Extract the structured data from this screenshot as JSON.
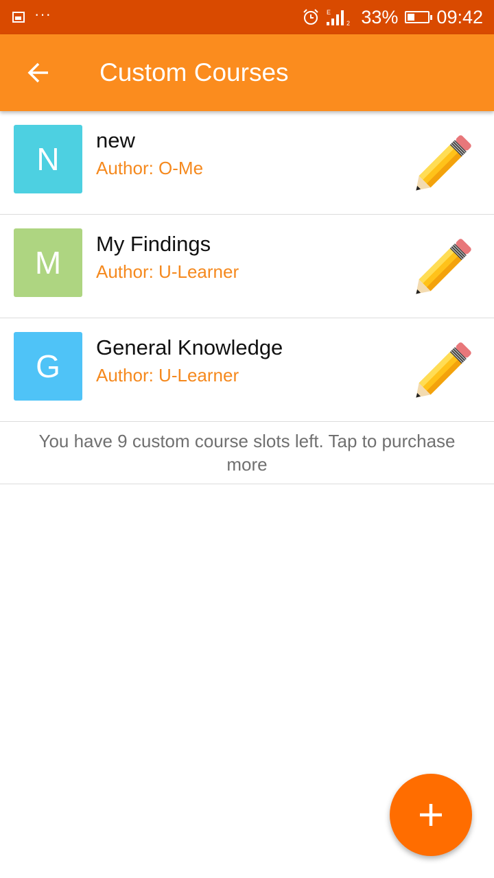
{
  "status_bar": {
    "battery_percent": "33%",
    "battery_level": 0.33,
    "time": "09:42",
    "icons": [
      "image-icon",
      "more-dots-icon",
      "alarm-icon",
      "signal-icon",
      "battery-icon"
    ],
    "dots": "···"
  },
  "app_bar": {
    "title": "Custom Courses",
    "back_icon": "arrow-back-icon",
    "background": "#fb8c1e"
  },
  "courses": [
    {
      "initial": "N",
      "title": "new",
      "author": "Author: O-Me",
      "avatar_color": "#4dd0e1",
      "action_icon": "pencil-icon"
    },
    {
      "initial": "M",
      "title": "My Findings",
      "author": "Author: U-Learner",
      "avatar_color": "#aed581",
      "action_icon": "pencil-icon"
    },
    {
      "initial": "G",
      "title": "General Knowledge",
      "author": "Author: U-Learner",
      "avatar_color": "#4fc3f7",
      "action_icon": "pencil-icon"
    }
  ],
  "slots_note": "You have 9 custom course slots left. Tap to purchase more",
  "fab": {
    "icon": "plus-icon",
    "color": "#ff6d00"
  },
  "colors": {
    "status_bar": "#d94a00",
    "accent": "#f5891e"
  }
}
